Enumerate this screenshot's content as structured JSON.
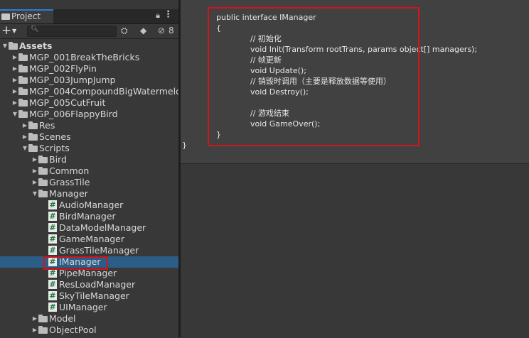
{
  "project_panel": {
    "tab_label": "Project",
    "hidden_count": "8",
    "search": {
      "value": ""
    },
    "tree": [
      {
        "label": "Assets",
        "depth": 0,
        "arrow": "▼",
        "icon": "folder",
        "bold": true
      },
      {
        "label": "MGP_001BreakTheBricks",
        "depth": 1,
        "arrow": "▶",
        "icon": "folder"
      },
      {
        "label": "MGP_002FlyPin",
        "depth": 1,
        "arrow": "▶",
        "icon": "folder"
      },
      {
        "label": "MGP_003JumpJump",
        "depth": 1,
        "arrow": "▶",
        "icon": "folder"
      },
      {
        "label": "MGP_004CompoundBigWatermelon",
        "depth": 1,
        "arrow": "▶",
        "icon": "folder"
      },
      {
        "label": "MGP_005CutFruit",
        "depth": 1,
        "arrow": "▶",
        "icon": "folder"
      },
      {
        "label": "MGP_006FlappyBird",
        "depth": 1,
        "arrow": "▼",
        "icon": "folder"
      },
      {
        "label": "Res",
        "depth": 2,
        "arrow": "▶",
        "icon": "folder"
      },
      {
        "label": "Scenes",
        "depth": 2,
        "arrow": "▶",
        "icon": "folder"
      },
      {
        "label": "Scripts",
        "depth": 2,
        "arrow": "▼",
        "icon": "folder"
      },
      {
        "label": "Bird",
        "depth": 3,
        "arrow": "▶",
        "icon": "folder"
      },
      {
        "label": "Common",
        "depth": 3,
        "arrow": "▶",
        "icon": "folder"
      },
      {
        "label": "GrassTile",
        "depth": 3,
        "arrow": "▶",
        "icon": "folder"
      },
      {
        "label": "Manager",
        "depth": 3,
        "arrow": "▼",
        "icon": "folder"
      },
      {
        "label": "AudioManager",
        "depth": 4,
        "arrow": "",
        "icon": "script"
      },
      {
        "label": "BirdManager",
        "depth": 4,
        "arrow": "",
        "icon": "script"
      },
      {
        "label": "DataModelManager",
        "depth": 4,
        "arrow": "",
        "icon": "script"
      },
      {
        "label": "GameManager",
        "depth": 4,
        "arrow": "",
        "icon": "script"
      },
      {
        "label": "GrassTileManager",
        "depth": 4,
        "arrow": "",
        "icon": "script"
      },
      {
        "label": "IManager",
        "depth": 4,
        "arrow": "",
        "icon": "script",
        "selected": true
      },
      {
        "label": "PipeManager",
        "depth": 4,
        "arrow": "",
        "icon": "script"
      },
      {
        "label": "ResLoadManager",
        "depth": 4,
        "arrow": "",
        "icon": "script"
      },
      {
        "label": "SkyTileManager",
        "depth": 4,
        "arrow": "",
        "icon": "script"
      },
      {
        "label": "UIManager",
        "depth": 4,
        "arrow": "",
        "icon": "script"
      },
      {
        "label": "Model",
        "depth": 3,
        "arrow": "▶",
        "icon": "folder"
      },
      {
        "label": "ObjectPool",
        "depth": 3,
        "arrow": "▶",
        "icon": "folder"
      }
    ]
  },
  "code_view": {
    "lines": [
      {
        "text": "public interface IManager",
        "indent": 0
      },
      {
        "text": "{",
        "indent": 0
      },
      {
        "text": "// 初始化",
        "indent": 1
      },
      {
        "text": "void Init(Transform rootTrans, params object[] managers);",
        "indent": 1
      },
      {
        "text": "// 帧更新",
        "indent": 1
      },
      {
        "text": "void Update();",
        "indent": 1
      },
      {
        "text": "// 销毁时调用（主要是释放数据等使用）",
        "indent": 1
      },
      {
        "text": "void Destroy();",
        "indent": 1
      },
      {
        "text": "",
        "indent": 1
      },
      {
        "text": "// 游戏结束",
        "indent": 1
      },
      {
        "text": "void GameOver();",
        "indent": 1
      },
      {
        "text": "}",
        "indent": 0
      }
    ],
    "outer_close": "}"
  },
  "colors": {
    "selection": "#2c5d87",
    "highlight_box": "#d2141e",
    "script_icon": "#1e7a3c"
  }
}
